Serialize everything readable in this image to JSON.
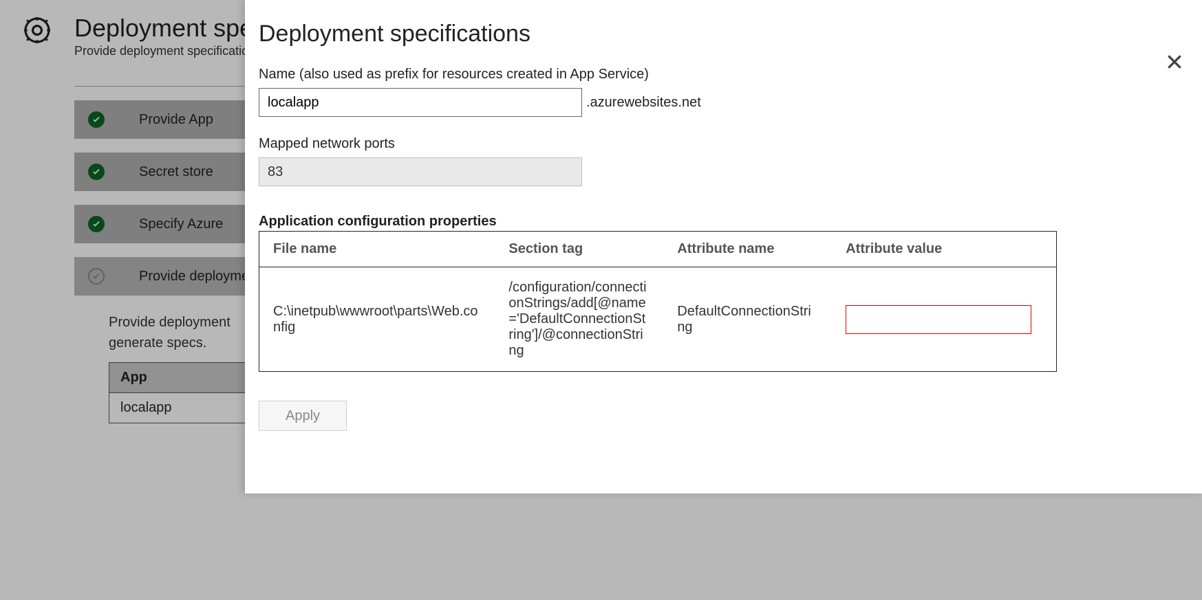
{
  "bg": {
    "title": "Deployment specifications",
    "subtitle": "Provide deployment specifications",
    "steps": [
      {
        "label": "Provide App",
        "done": true
      },
      {
        "label": "Secret store",
        "done": true
      },
      {
        "label": "Specify Azure",
        "done": true
      },
      {
        "label": "Provide deployment",
        "done": false
      }
    ],
    "details": {
      "line1": "Provide deployment",
      "line2": "generate specs.",
      "table": {
        "header": "App",
        "row": "localapp"
      }
    }
  },
  "modal": {
    "title": "Deployment specifications",
    "name_label": "Name (also used as prefix for resources created in App Service)",
    "name_value": "localapp",
    "name_suffix": ".azurewebsites.net",
    "ports_label": "Mapped network ports",
    "ports_value": "83",
    "props_title": "Application configuration properties",
    "table": {
      "headers": {
        "file": "File name",
        "section": "Section tag",
        "attr": "Attribute name",
        "val": "Attribute value"
      },
      "row": {
        "file": "C:\\inetpub\\wwwroot\\parts\\Web.config",
        "section": "/configuration/connectionStrings/add[@name='DefaultConnectionString']/@connectionString",
        "attr": "DefaultConnectionString",
        "val": ""
      }
    },
    "apply_label": "Apply"
  }
}
